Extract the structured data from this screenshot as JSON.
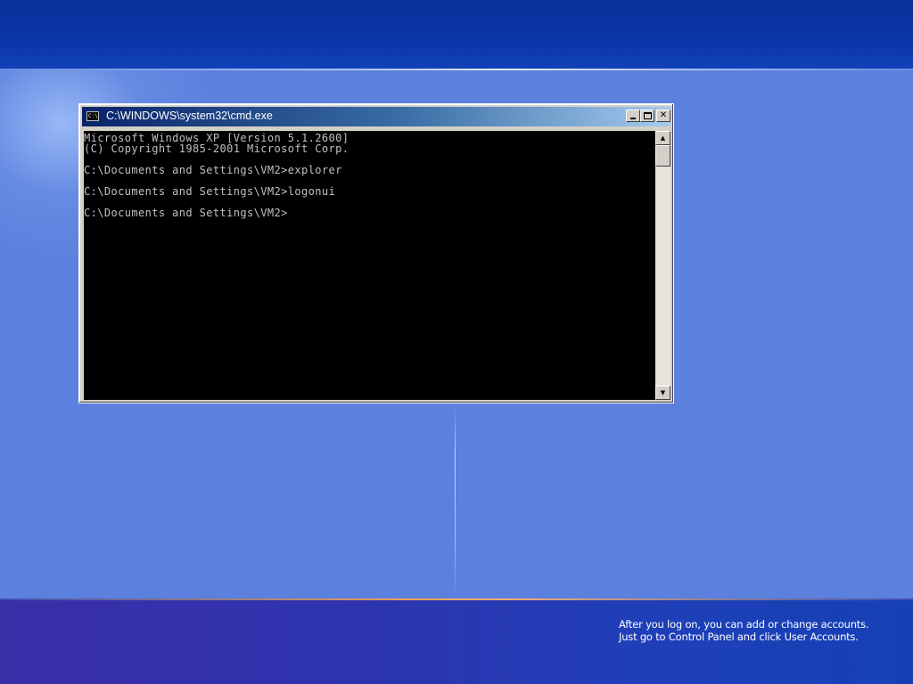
{
  "window": {
    "title": "C:\\WINDOWS\\system32\\cmd.exe",
    "icon_label": "C:\\",
    "close_glyph": "✕"
  },
  "console": {
    "lines": [
      "Microsoft Windows XP [Version 5.1.2600]",
      "(C) Copyright 1985-2001 Microsoft Corp.",
      "",
      "C:\\Documents and Settings\\VM2>explorer",
      "",
      "C:\\Documents and Settings\\VM2>logonui",
      "",
      "C:\\Documents and Settings\\VM2>"
    ]
  },
  "scrollbar": {
    "up_glyph": "▲",
    "down_glyph": "▼"
  },
  "welcome_info": {
    "line1": "After you log on, you can add or change accounts.",
    "line2": "Just go to Control Panel and click User Accounts."
  },
  "colors": {
    "console_bg": "#000000",
    "console_fg": "#c0c0c0",
    "titlebar_start": "#0a246a",
    "titlebar_end": "#a6caf0",
    "desktop_blue": "#5b80dd"
  },
  "icons": [
    "cmd-icon",
    "minimize-icon",
    "maximize-icon",
    "close-icon",
    "scroll-up-icon",
    "scroll-down-icon"
  ]
}
